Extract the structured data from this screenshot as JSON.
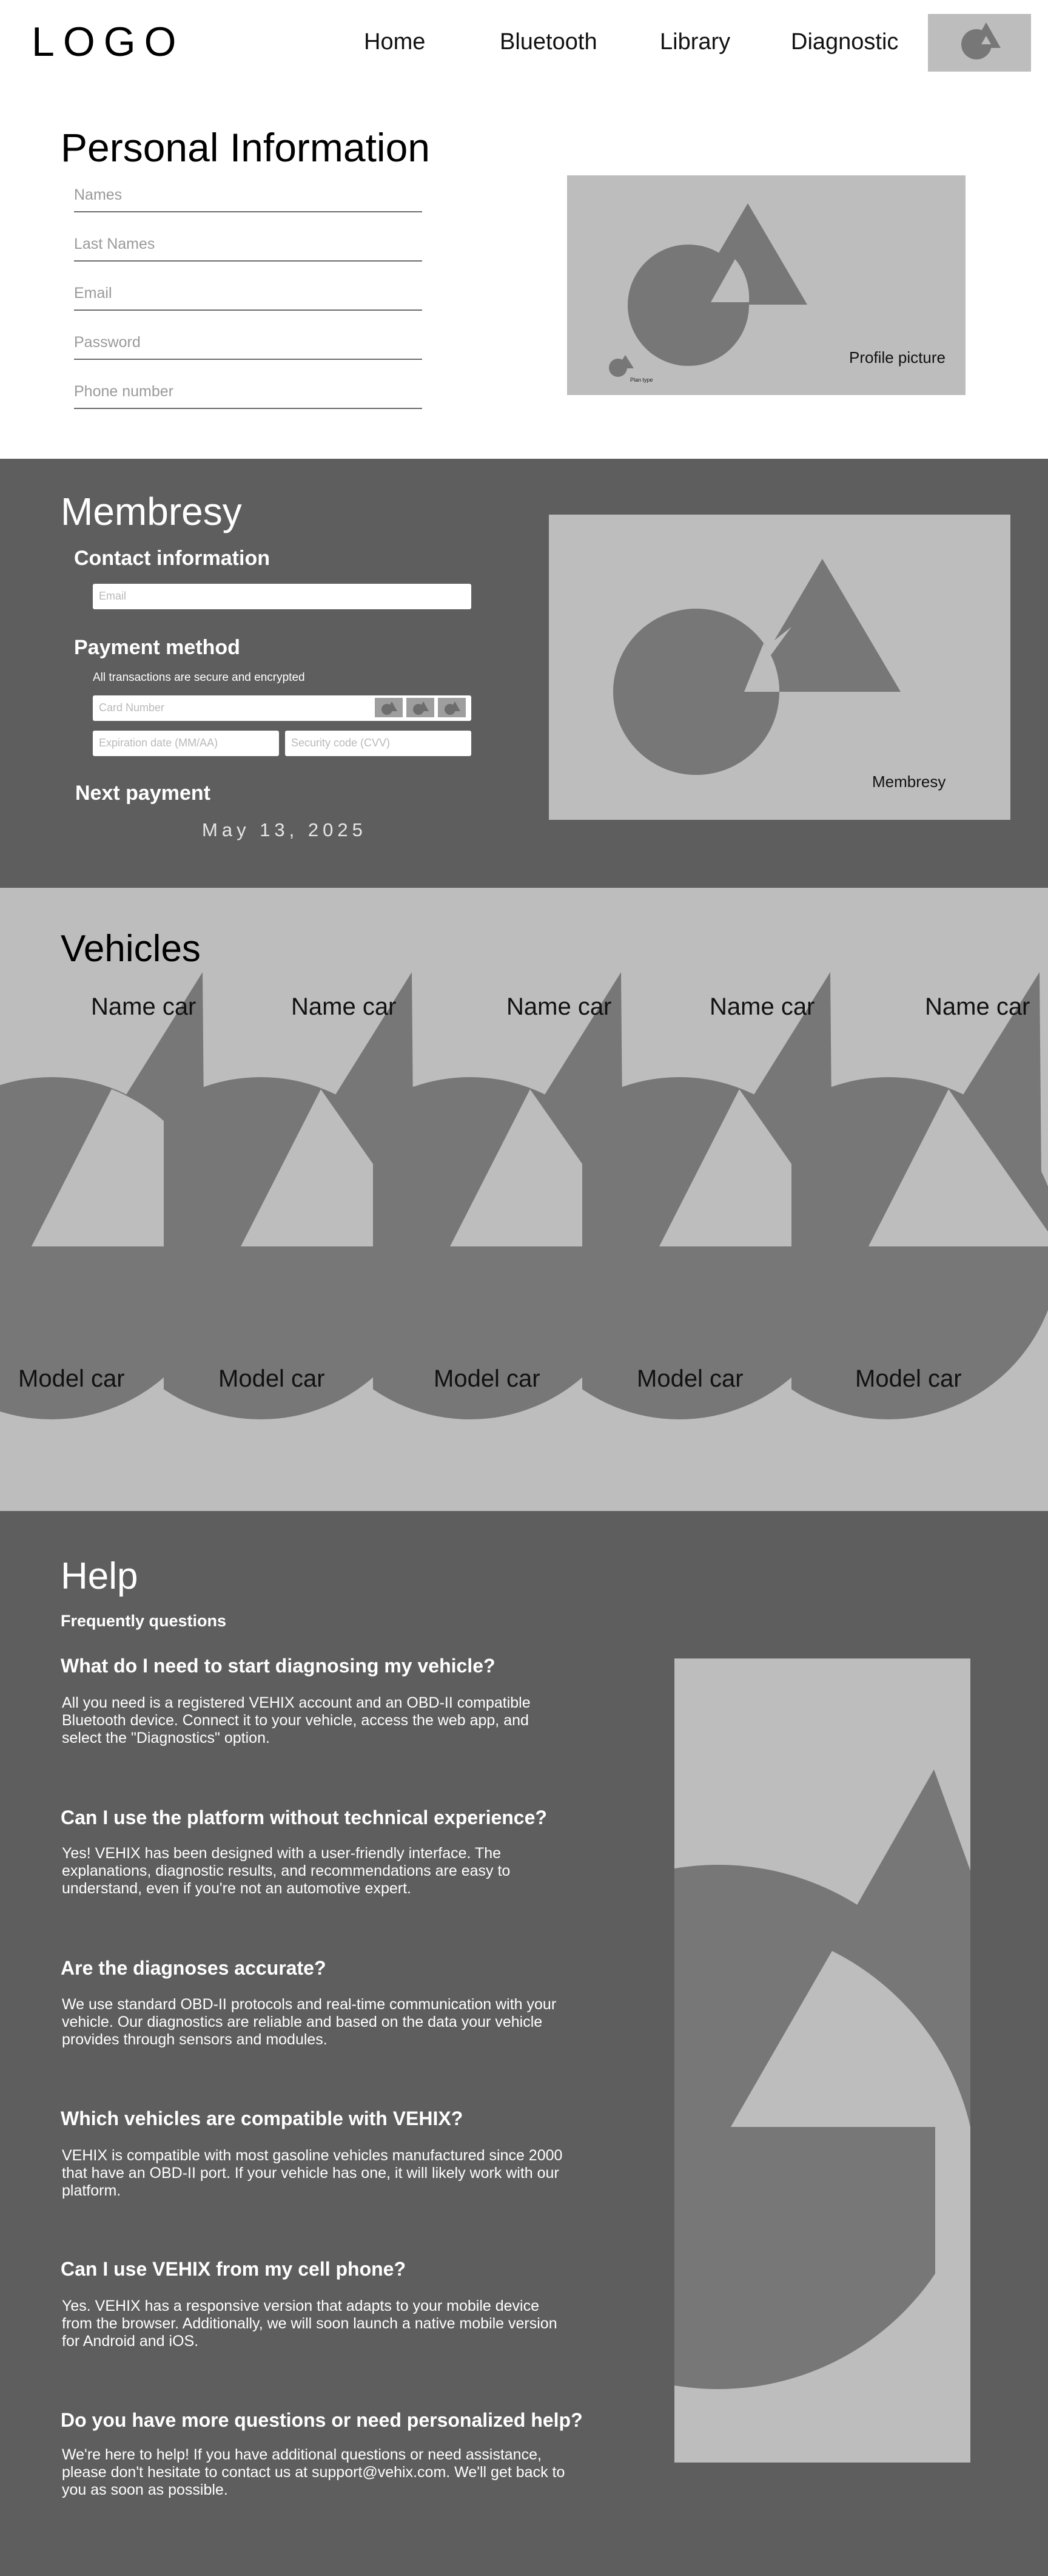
{
  "header": {
    "logo": "LOGO",
    "nav": [
      "Home",
      "Bluetooth",
      "Library",
      "Diagnostic"
    ]
  },
  "personal": {
    "title": "Personal Information",
    "fields": [
      "Names",
      "Last Names",
      "Email",
      "Password",
      "Phone number"
    ],
    "profile_label": "Profile picture",
    "plan_label": "Plan type"
  },
  "membresy": {
    "title": "Membresy",
    "contact_title": "Contact information",
    "email_placeholder": "Email",
    "payment_title": "Payment method",
    "secure_note": "All transactions are secure and encrypted",
    "card_placeholder": "Card Number",
    "expiration_placeholder": "Expiration date (MM/AA)",
    "security_placeholder": "Security code (CVV)",
    "next_payment_title": "Next payment",
    "next_payment_date": "May 13, 2025",
    "image_label": "Membresy"
  },
  "vehicles": {
    "title": "Vehicles",
    "items": [
      {
        "name": "Name car",
        "model": "Model car"
      },
      {
        "name": "Name car",
        "model": "Model car"
      },
      {
        "name": "Name car",
        "model": "Model car"
      },
      {
        "name": "Name car",
        "model": "Model car"
      },
      {
        "name": "Name car",
        "model": "Model car"
      }
    ]
  },
  "help": {
    "title": "Help",
    "faq_label": "Frequently questions",
    "faqs": [
      {
        "q": "What do I need to start diagnosing my vehicle?",
        "a": "All you need is a registered VEHIX account and an OBD-II compatible Bluetooth device. Connect it to your vehicle, access the web app, and select the \"Diagnostics\" option."
      },
      {
        "q": "Can I use the platform without technical experience?",
        "a": "Yes! VEHIX has been designed with a user-friendly interface. The explanations, diagnostic results, and recommendations are easy to understand, even if you're not an automotive expert."
      },
      {
        "q": "Are the diagnoses accurate?",
        "a": "We use standard OBD-II protocols and real-time communication with your vehicle. Our diagnostics are reliable and based on the data your vehicle provides through sensors and modules."
      },
      {
        "q": "Which vehicles are compatible with VEHIX?",
        "a": "VEHIX is compatible with most gasoline vehicles manufactured since 2000 that have an OBD-II port. If your vehicle has one, it will likely work with our platform."
      },
      {
        "q": "Can I use VEHIX from my cell phone?",
        "a": "Yes. VEHIX has a responsive version that adapts to your mobile device from the browser. Additionally, we will soon launch a native mobile version for Android and iOS."
      },
      {
        "q": "Do you have more questions or need personalized help?",
        "a": "We're here to help! If you have additional questions or need assistance, please don't hesitate to contact us at support@vehix.com. We'll get back to you as soon as possible."
      }
    ]
  }
}
